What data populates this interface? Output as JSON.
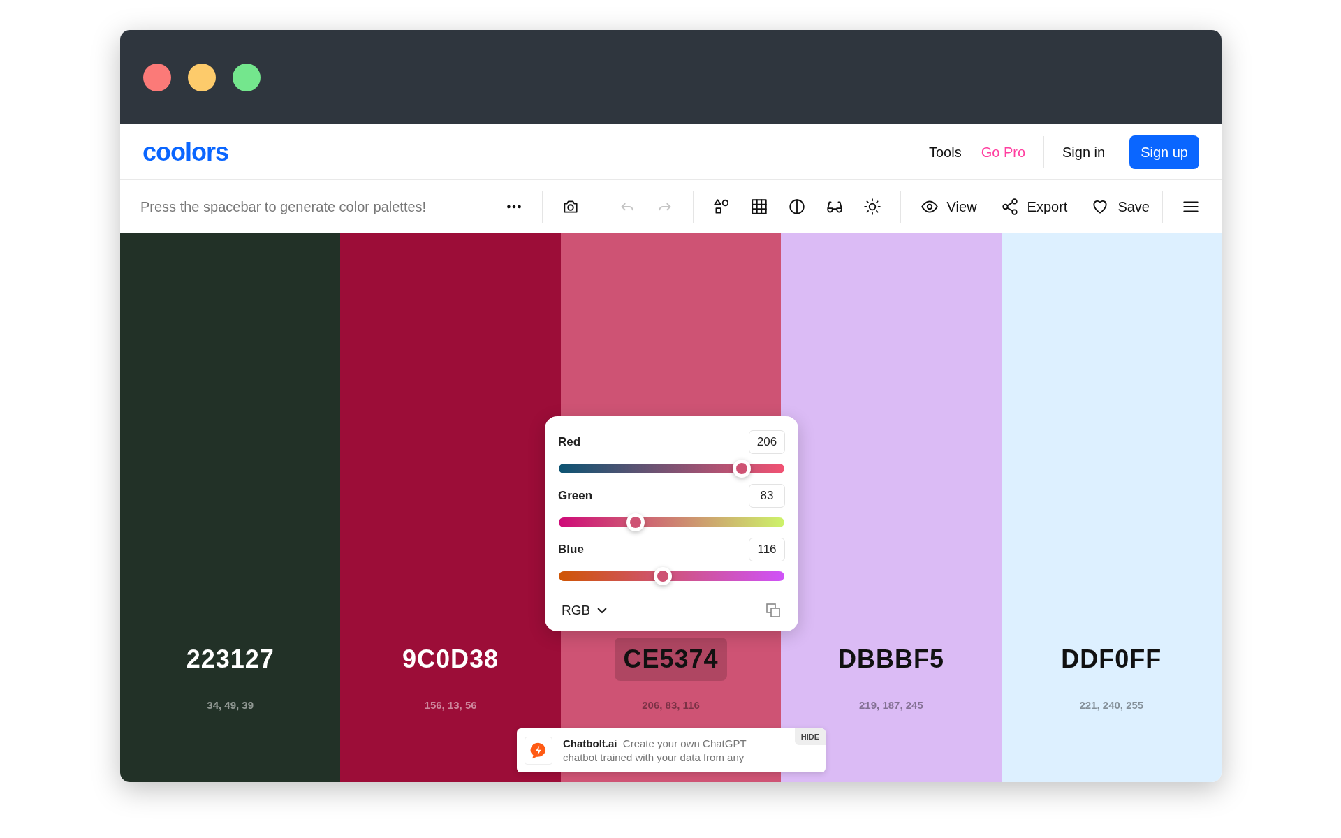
{
  "logo": "coolors",
  "nav": [
    {
      "label": "Tools",
      "kind": "link"
    },
    {
      "label": "Go Pro",
      "kind": "promo"
    },
    {
      "label": "Sign in",
      "kind": "link"
    },
    {
      "label": "Sign up",
      "kind": "primary"
    }
  ],
  "toolbar": {
    "message": "Press the spacebar to generate color palettes!",
    "undo": {
      "disabled": true
    },
    "redo": {
      "disabled": true
    },
    "view": "View",
    "export": "Export",
    "save": "Save"
  },
  "palette": [
    {
      "color": "#223127",
      "hex": "223127",
      "rgb": "34, 49, 39",
      "selected": false
    },
    {
      "color": "#9c0d38",
      "hex": "9C0D38",
      "rgb": "156, 13, 56",
      "selected": false
    },
    {
      "color": "#ce5374",
      "hex": "CE5374",
      "rgb": "206, 83, 116",
      "selected": true
    },
    {
      "color": "#dbbbf5",
      "hex": "DBBBF5",
      "rgb": "219, 187, 245",
      "selected": false
    },
    {
      "color": "#ddf0ff",
      "hex": "DDF0FF",
      "rgb": "221, 240, 255",
      "selected": false
    }
  ],
  "picker": {
    "channels": [
      {
        "name": "Red",
        "value": "206",
        "level": 0.81
      },
      {
        "name": "Green",
        "value": "83",
        "level": 0.34
      },
      {
        "name": "Blue",
        "value": "116",
        "level": 0.46
      }
    ],
    "mode": "RGB"
  },
  "ad": {
    "brand": "Chatbolt.ai",
    "text": "Create your own ChatGPT chatbot trained with your data from any",
    "hide": "HIDE"
  }
}
